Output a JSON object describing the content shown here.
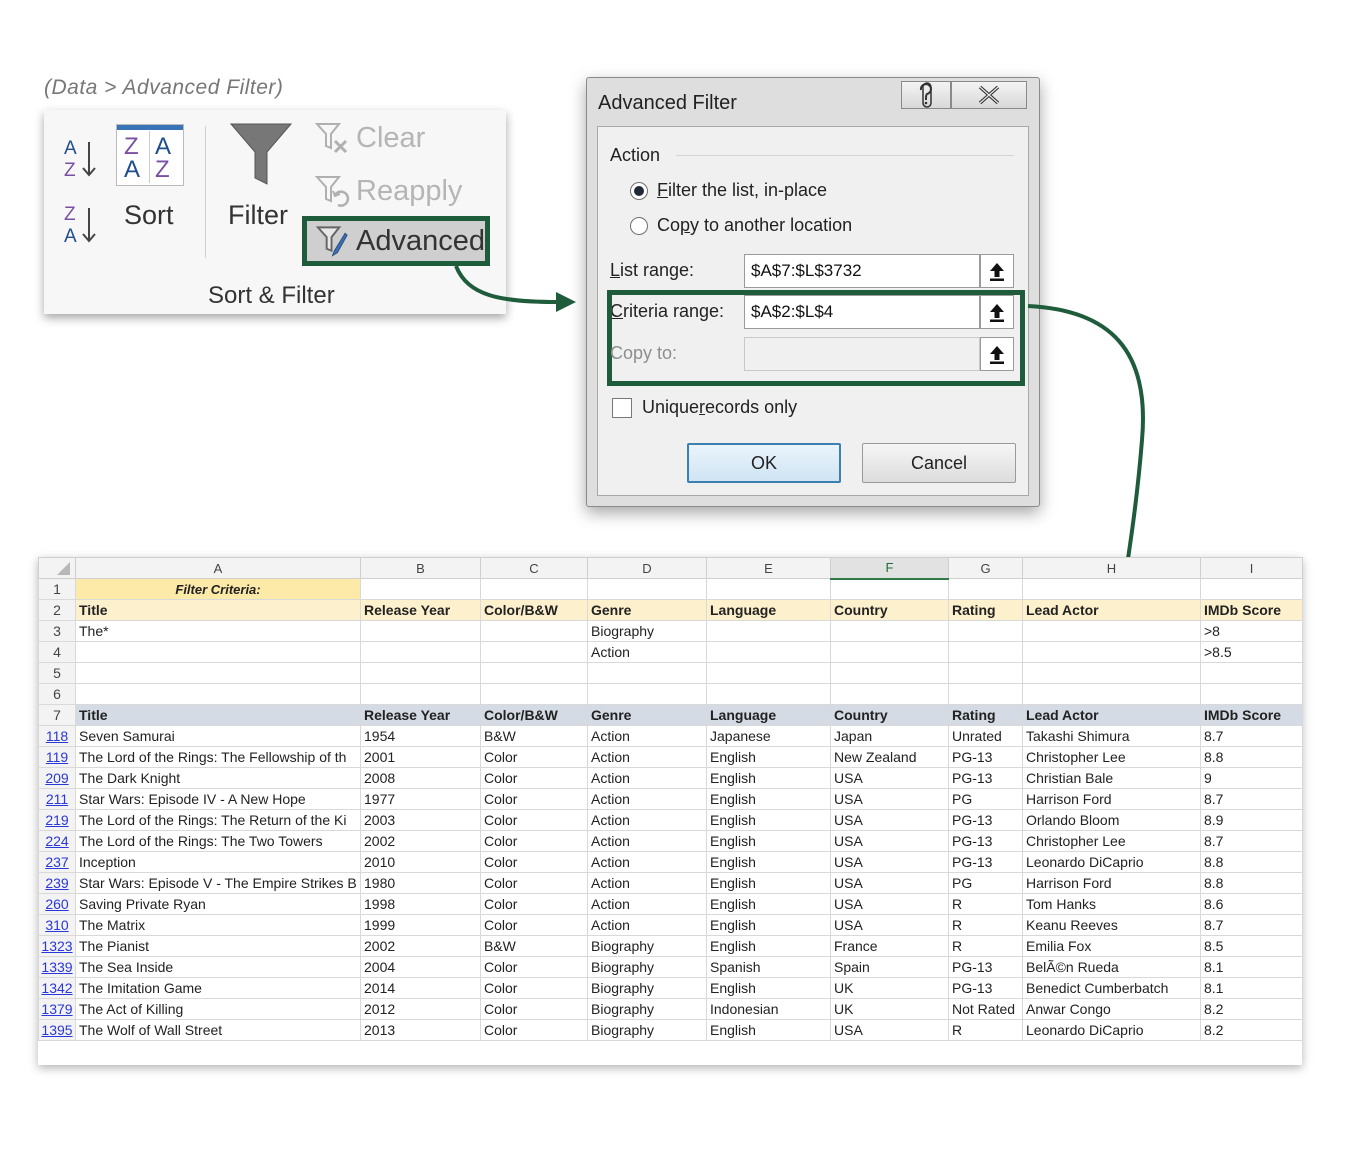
{
  "caption": "(Data > Advanced Filter)",
  "ribbon": {
    "sort_label": "Sort",
    "sort_big_letters": {
      "tl": "Z",
      "tr": "A",
      "bl": "A",
      "br": "Z"
    },
    "sort_az_icon": "sort-a-to-z-icon",
    "sort_za_icon": "sort-z-to-a-icon",
    "filter_label": "Filter",
    "clear_label": "Clear",
    "reapply_label": "Reapply",
    "advanced_label": "Advanced",
    "group_label": "Sort & Filter"
  },
  "dialog": {
    "title": "Advanced Filter",
    "help_icon": "help-icon",
    "close_icon": "close-icon",
    "action_label": "Action",
    "radio_filter": {
      "first": "F",
      "rest": "ilter the list, in-place"
    },
    "radio_copy": {
      "first": "Co",
      "mid": "p",
      "rest": "y to another location"
    },
    "list_range": {
      "first": "L",
      "rest": "ist range:",
      "value": "$A$7:$L$3732"
    },
    "criteria_range": {
      "first": "C",
      "rest": "riteria range:",
      "value": "$A$2:$L$4"
    },
    "copy_to": {
      "label": "Copy to:",
      "value": ""
    },
    "unique": {
      "a": "Unique ",
      "u": "r",
      "b": "ecords only"
    },
    "ok_label": "OK",
    "cancel_label": "Cancel",
    "selected_action": "filter"
  },
  "sheet": {
    "columns": [
      "A",
      "B",
      "C",
      "D",
      "E",
      "F",
      "G",
      "H",
      "I"
    ],
    "filter_criteria_label": "Filter Criteria:",
    "headers": [
      "Title",
      "Release Year",
      "Color/B&W",
      "Genre",
      "Language",
      "Country",
      "Rating",
      "Lead Actor",
      "IMDb Score"
    ],
    "criteria": [
      [
        "The*",
        "",
        "",
        "Biography",
        "",
        "",
        "",
        "",
        ">8"
      ],
      [
        "",
        "",
        "",
        "Action",
        "",
        "",
        "",
        "",
        ">8.5"
      ]
    ],
    "row_numbers": {
      "r1": "1",
      "r2": "2",
      "r3": "3",
      "r4": "4",
      "r5": "5",
      "r6": "6",
      "r7": "7"
    },
    "rows": [
      {
        "n": "118",
        "cells": [
          "Seven Samurai",
          "1954",
          "B&W",
          "Action",
          "Japanese",
          "Japan",
          "Unrated",
          "Takashi Shimura",
          "8.7"
        ]
      },
      {
        "n": "119",
        "cells": [
          "The Lord of the Rings: The Fellowship of th",
          "2001",
          "Color",
          "Action",
          "English",
          "New Zealand",
          "PG-13",
          "Christopher Lee",
          "8.8"
        ]
      },
      {
        "n": "209",
        "cells": [
          "The Dark Knight",
          "2008",
          "Color",
          "Action",
          "English",
          "USA",
          "PG-13",
          "Christian Bale",
          "9"
        ]
      },
      {
        "n": "211",
        "cells": [
          "Star Wars: Episode IV - A New Hope",
          "1977",
          "Color",
          "Action",
          "English",
          "USA",
          "PG",
          "Harrison Ford",
          "8.7"
        ]
      },
      {
        "n": "219",
        "cells": [
          "The Lord of the Rings: The Return of the Ki",
          "2003",
          "Color",
          "Action",
          "English",
          "USA",
          "PG-13",
          "Orlando Bloom",
          "8.9"
        ]
      },
      {
        "n": "224",
        "cells": [
          "The Lord of the Rings: The Two Towers",
          "2002",
          "Color",
          "Action",
          "English",
          "USA",
          "PG-13",
          "Christopher Lee",
          "8.7"
        ]
      },
      {
        "n": "237",
        "cells": [
          "Inception",
          "2010",
          "Color",
          "Action",
          "English",
          "USA",
          "PG-13",
          "Leonardo DiCaprio",
          "8.8"
        ]
      },
      {
        "n": "239",
        "cells": [
          "Star Wars: Episode V - The Empire Strikes B",
          "1980",
          "Color",
          "Action",
          "English",
          "USA",
          "PG",
          "Harrison Ford",
          "8.8"
        ]
      },
      {
        "n": "260",
        "cells": [
          "Saving Private Ryan",
          "1998",
          "Color",
          "Action",
          "English",
          "USA",
          "R",
          "Tom Hanks",
          "8.6"
        ]
      },
      {
        "n": "310",
        "cells": [
          "The Matrix",
          "1999",
          "Color",
          "Action",
          "English",
          "USA",
          "R",
          "Keanu Reeves",
          "8.7"
        ]
      },
      {
        "n": "1323",
        "cells": [
          "The Pianist",
          "2002",
          "B&W",
          "Biography",
          "English",
          "France",
          "R",
          "Emilia Fox",
          "8.5"
        ]
      },
      {
        "n": "1339",
        "cells": [
          "The Sea Inside",
          "2004",
          "Color",
          "Biography",
          "Spanish",
          "Spain",
          "PG-13",
          "BelÃ©n Rueda",
          "8.1"
        ]
      },
      {
        "n": "1342",
        "cells": [
          "The Imitation Game",
          "2014",
          "Color",
          "Biography",
          "English",
          "UK",
          "PG-13",
          "Benedict Cumberbatch",
          "8.1"
        ]
      },
      {
        "n": "1379",
        "cells": [
          "The Act of Killing",
          "2012",
          "Color",
          "Biography",
          "Indonesian",
          "UK",
          "Not Rated",
          "Anwar Congo",
          "8.2"
        ]
      },
      {
        "n": "1395",
        "cells": [
          "The Wolf of Wall Street",
          "2013",
          "Color",
          "Biography",
          "English",
          "USA",
          "R",
          "Leonardo DiCaprio",
          "8.2"
        ]
      }
    ]
  },
  "colors": {
    "highlight_green": "#1f5c3c",
    "criteria_title": "#fde9a8",
    "criteria_header": "#fdf0cc",
    "data_header": "#d4dbe4",
    "row_link": "#2a37d9"
  }
}
